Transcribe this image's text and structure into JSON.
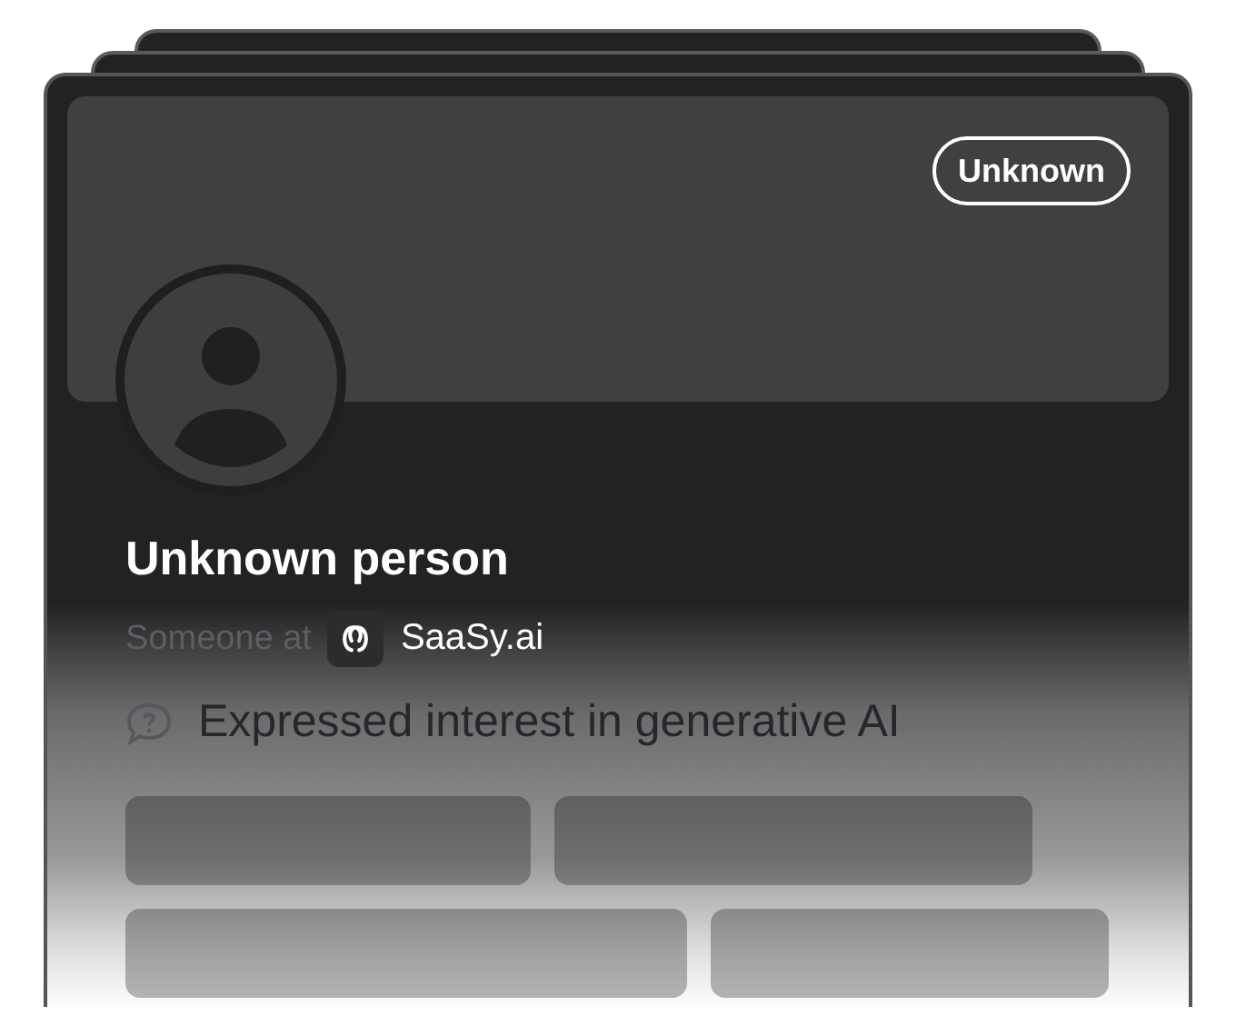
{
  "badge": "Unknown",
  "person": {
    "name": "Unknown person",
    "role_prefix": "Someone at",
    "company": "SaaSy.ai"
  },
  "interest": "Expressed interest in generative AI"
}
